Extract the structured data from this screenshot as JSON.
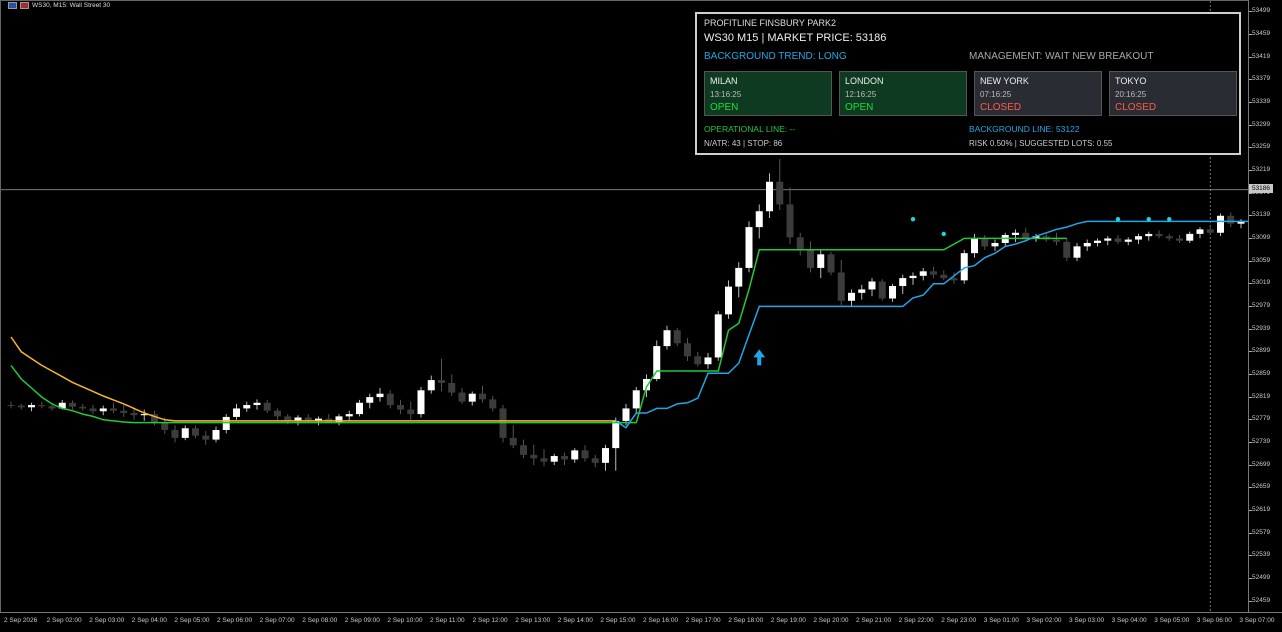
{
  "header": {
    "symbol_label": "WS30, M15:  Wall Street 30"
  },
  "info_panel": {
    "line1": "PROFITLINE FINSBURY PARK2",
    "line2": "WS30 M15  |  MARKET PRICE: 53186",
    "trend": "BACKGROUND TREND: LONG",
    "management": "MANAGEMENT: WAIT NEW BREAKOUT",
    "sessions": [
      {
        "name": "MILAN",
        "time": "13:16:25",
        "status": "OPEN"
      },
      {
        "name": "LONDON",
        "time": "12:16:25",
        "status": "OPEN"
      },
      {
        "name": "NEW YORK",
        "time": "07:16:25",
        "status": "CLOSED"
      },
      {
        "name": "TOKYO",
        "time": "20:16:25",
        "status": "CLOSED"
      }
    ],
    "operational_line": "OPERATIONAL LINE: --",
    "background_line": "BACKGROUND LINE: 53122",
    "natr": "N/ATR: 43 | STOP: 86",
    "risk": "RISK 0.50% | SUGGESTED LOTS: 0.55"
  },
  "colors": {
    "bg": "#000000",
    "bull": "#ffffff",
    "bear": "#3c3c3c",
    "yellow_line": "#f5b82a",
    "green_line": "#22c93a",
    "blue_line": "#1fa8e8",
    "cyan_dot": "#19d6e0",
    "signal_arrow": "#1fa8e8",
    "trend_text": "#1fa8e8",
    "oper_text": "#22c93a",
    "bg_line_text": "#1fa8e8"
  },
  "price_scale": {
    "ticks": [
      "53499",
      "53459",
      "53419",
      "53379",
      "53339",
      "53299",
      "53259",
      "53219",
      "53179",
      "53139",
      "53099",
      "53059",
      "53019",
      "52979",
      "52939",
      "52899",
      "52859",
      "52819",
      "52779",
      "52739",
      "52699",
      "52659",
      "52619",
      "52579",
      "52539",
      "52499",
      "52459"
    ],
    "current_price_label": "53186"
  },
  "time_scale": {
    "ticks": [
      "2 Sep 2026",
      "2 Sep 02:00",
      "2 Sep 03:00",
      "2 Sep 04:00",
      "2 Sep 05:00",
      "2 Sep 06:00",
      "2 Sep 07:00",
      "2 Sep 08:00",
      "2 Sep 09:00",
      "2 Sep 10:00",
      "2 Sep 11:00",
      "2 Sep 12:00",
      "2 Sep 13:00",
      "2 Sep 14:00",
      "2 Sep 15:00",
      "2 Sep 16:00",
      "2 Sep 17:00",
      "2 Sep 18:00",
      "2 Sep 19:00",
      "2 Sep 20:00",
      "2 Sep 21:00",
      "2 Sep 22:00",
      "2 Sep 23:00",
      "3 Sep 01:00",
      "3 Sep 02:00",
      "3 Sep 03:00",
      "3 Sep 04:00",
      "3 Sep 05:00",
      "3 Sep 06:00",
      "3 Sep 07:00"
    ]
  },
  "chart_data": {
    "type": "candlestick",
    "ylim": [
      52439,
      53519
    ],
    "current_price": 53186,
    "candles": [
      [
        52806,
        52812,
        52800,
        52805
      ],
      [
        52805,
        52808,
        52798,
        52802
      ],
      [
        52802,
        52810,
        52795,
        52806
      ],
      [
        52806,
        52812,
        52800,
        52804
      ],
      [
        52804,
        52808,
        52796,
        52800
      ],
      [
        52800,
        52815,
        52798,
        52810
      ],
      [
        52810,
        52814,
        52798,
        52803
      ],
      [
        52803,
        52808,
        52796,
        52800
      ],
      [
        52800,
        52806,
        52790,
        52795
      ],
      [
        52795,
        52805,
        52788,
        52800
      ],
      [
        52800,
        52810,
        52792,
        52796
      ],
      [
        52796,
        52806,
        52785,
        52792
      ],
      [
        52792,
        52800,
        52780,
        52788
      ],
      [
        52788,
        52798,
        52778,
        52790
      ],
      [
        52790,
        52796,
        52770,
        52776
      ],
      [
        52776,
        52784,
        52755,
        52762
      ],
      [
        52762,
        52770,
        52740,
        52748
      ],
      [
        52748,
        52770,
        52744,
        52765
      ],
      [
        52765,
        52770,
        52748,
        52752
      ],
      [
        52752,
        52760,
        52736,
        52745
      ],
      [
        52745,
        52768,
        52740,
        52762
      ],
      [
        52762,
        52790,
        52756,
        52785
      ],
      [
        52785,
        52808,
        52780,
        52800
      ],
      [
        52800,
        52812,
        52794,
        52806
      ],
      [
        52806,
        52816,
        52798,
        52810
      ],
      [
        52810,
        52815,
        52792,
        52796
      ],
      [
        52796,
        52800,
        52780,
        52786
      ],
      [
        52786,
        52790,
        52772,
        52778
      ],
      [
        52778,
        52788,
        52770,
        52784
      ],
      [
        52784,
        52790,
        52774,
        52778
      ],
      [
        52778,
        52786,
        52770,
        52782
      ],
      [
        52782,
        52790,
        52774,
        52776
      ],
      [
        52776,
        52790,
        52770,
        52786
      ],
      [
        52786,
        52796,
        52778,
        52790
      ],
      [
        52790,
        52815,
        52786,
        52810
      ],
      [
        52810,
        52826,
        52800,
        52820
      ],
      [
        52820,
        52836,
        52812,
        52826
      ],
      [
        52826,
        52832,
        52800,
        52806
      ],
      [
        52806,
        52815,
        52790,
        52798
      ],
      [
        52798,
        52812,
        52780,
        52790
      ],
      [
        52790,
        52838,
        52784,
        52832
      ],
      [
        52832,
        52858,
        52826,
        52850
      ],
      [
        52850,
        52888,
        52830,
        52845
      ],
      [
        52845,
        52860,
        52822,
        52828
      ],
      [
        52828,
        52836,
        52808,
        52812
      ],
      [
        52812,
        52830,
        52805,
        52826
      ],
      [
        52826,
        52840,
        52810,
        52816
      ],
      [
        52816,
        52822,
        52795,
        52800
      ],
      [
        52800,
        52806,
        52740,
        52748
      ],
      [
        52748,
        52770,
        52730,
        52735
      ],
      [
        52735,
        52745,
        52712,
        52718
      ],
      [
        52718,
        52736,
        52700,
        52712
      ],
      [
        52712,
        52728,
        52698,
        52706
      ],
      [
        52706,
        52720,
        52700,
        52716
      ],
      [
        52716,
        52722,
        52700,
        52710
      ],
      [
        52710,
        52730,
        52704,
        52726
      ],
      [
        52726,
        52735,
        52706,
        52712
      ],
      [
        52712,
        52718,
        52696,
        52704
      ],
      [
        52704,
        52736,
        52690,
        52730
      ],
      [
        52730,
        52784,
        52690,
        52778
      ],
      [
        52778,
        52808,
        52770,
        52800
      ],
      [
        52800,
        52838,
        52792,
        52832
      ],
      [
        52832,
        52860,
        52820,
        52852
      ],
      [
        52852,
        52920,
        52848,
        52910
      ],
      [
        52910,
        52946,
        52904,
        52938
      ],
      [
        52938,
        52942,
        52910,
        52915
      ],
      [
        52915,
        52924,
        52884,
        52892
      ],
      [
        52892,
        52900,
        52874,
        52878
      ],
      [
        52878,
        52898,
        52870,
        52890
      ],
      [
        52890,
        52972,
        52884,
        52966
      ],
      [
        52966,
        53026,
        52958,
        53015
      ],
      [
        53015,
        53058,
        52996,
        53048
      ],
      [
        53048,
        53130,
        53040,
        53120
      ],
      [
        53120,
        53160,
        53100,
        53148
      ],
      [
        53148,
        53215,
        53136,
        53200
      ],
      [
        53200,
        53240,
        53150,
        53160
      ],
      [
        53160,
        53190,
        53090,
        53102
      ],
      [
        53102,
        53110,
        53070,
        53080
      ],
      [
        53080,
        53095,
        53040,
        53048
      ],
      [
        53048,
        53080,
        53030,
        53072
      ],
      [
        53072,
        53076,
        53035,
        53040
      ],
      [
        53040,
        53062,
        52982,
        52990
      ],
      [
        52990,
        53010,
        52980,
        53004
      ],
      [
        53004,
        53018,
        52992,
        53010
      ],
      [
        53010,
        53030,
        52998,
        53024
      ],
      [
        53024,
        53028,
        52990,
        52994
      ],
      [
        52994,
        53020,
        52988,
        53016
      ],
      [
        53016,
        53036,
        53002,
        53030
      ],
      [
        53030,
        53040,
        53018,
        53034
      ],
      [
        53034,
        53048,
        53026,
        53042
      ],
      [
        53042,
        53050,
        53030,
        53036
      ],
      [
        53036,
        53044,
        53026,
        53030
      ],
      [
        53030,
        53040,
        53020,
        53026
      ],
      [
        53026,
        53080,
        53020,
        53074
      ],
      [
        53074,
        53108,
        53066,
        53100
      ],
      [
        53100,
        53106,
        53080,
        53086
      ],
      [
        53086,
        53098,
        53078,
        53092
      ],
      [
        53092,
        53110,
        53086,
        53106
      ],
      [
        53106,
        53116,
        53094,
        53110
      ],
      [
        53110,
        53118,
        53094,
        53100
      ],
      [
        53100,
        53108,
        53094,
        53104
      ],
      [
        53104,
        53108,
        53094,
        53098
      ],
      [
        53098,
        53110,
        53088,
        53094
      ],
      [
        53094,
        53100,
        53060,
        53066
      ],
      [
        53066,
        53092,
        53060,
        53086
      ],
      [
        53086,
        53098,
        53078,
        53092
      ],
      [
        53092,
        53100,
        53086,
        53096
      ],
      [
        53096,
        53104,
        53088,
        53100
      ],
      [
        53100,
        53106,
        53090,
        53094
      ],
      [
        53094,
        53102,
        53088,
        53098
      ],
      [
        53098,
        53108,
        53090,
        53104
      ],
      [
        53104,
        53112,
        53096,
        53108
      ],
      [
        53108,
        53114,
        53100,
        53104
      ],
      [
        53104,
        53108,
        53096,
        53100
      ],
      [
        53100,
        53106,
        53092,
        53096
      ],
      [
        53096,
        53112,
        53092,
        53108
      ],
      [
        53108,
        53120,
        53100,
        53116
      ],
      [
        53116,
        53122,
        53106,
        53110
      ],
      [
        53110,
        53144,
        53104,
        53140
      ],
      [
        53140,
        53146,
        53120,
        53126
      ],
      [
        53126,
        53134,
        53118,
        53130
      ],
      [
        53130,
        53142,
        53122,
        53128
      ],
      [
        53128,
        53136,
        53118,
        53124
      ],
      [
        53124,
        53132,
        53116,
        53126
      ],
      [
        53126,
        53134,
        53118,
        53122
      ],
      [
        53122,
        53130,
        53116,
        53124
      ],
      [
        53124,
        53130,
        53118,
        53126
      ]
    ],
    "yellow_line": [
      52926,
      52900,
      52888,
      52876,
      52866,
      52856,
      52846,
      52838,
      52830,
      52822,
      52815,
      52808,
      52800,
      52792,
      52786,
      52780,
      52778,
      52778,
      52778,
      52778,
      52778,
      52778,
      52778,
      52778,
      52778,
      52778,
      52778,
      52778,
      52778,
      52778,
      52778,
      52778,
      52778,
      52778,
      52778,
      52778,
      52778,
      52778,
      52778,
      52778,
      52778,
      52778,
      52778,
      52778,
      52778,
      52778,
      52778,
      52778,
      52778,
      52778,
      52778,
      52778,
      52778,
      52778,
      52778,
      52778,
      52778,
      52778,
      52778,
      52778
    ],
    "green_line": [
      52876,
      52852,
      52836,
      52820,
      52808,
      52800,
      52796,
      52790,
      52786,
      52780,
      52778,
      52776,
      52775,
      52775,
      52775,
      52775,
      52775,
      52775,
      52775,
      52775,
      52775,
      52775,
      52775,
      52775,
      52775,
      52775,
      52775,
      52775,
      52775,
      52775,
      52775,
      52775,
      52775,
      52775,
      52775,
      52775,
      52775,
      52775,
      52775,
      52775,
      52775,
      52775,
      52775,
      52775,
      52775,
      52775,
      52775,
      52775,
      52775,
      52775,
      52775,
      52775,
      52775,
      52775,
      52775,
      52775,
      52775,
      52775,
      52775,
      52775,
      52775,
      52775,
      52838,
      52866,
      52866,
      52866,
      52866,
      52866,
      52866,
      52866,
      52938,
      52950,
      53010,
      53080,
      53080,
      53080,
      53080,
      53080,
      53080,
      53080,
      53080,
      53080,
      53080,
      53080,
      53080,
      53080,
      53080,
      53080,
      53080,
      53080,
      53080,
      53080,
      53090,
      53100,
      53100,
      53100,
      53100,
      53100,
      53100,
      53100,
      53100,
      53100,
      53100,
      53100
    ],
    "blue_line": [
      null,
      null,
      null,
      null,
      null,
      null,
      null,
      null,
      null,
      null,
      null,
      null,
      null,
      null,
      null,
      null,
      null,
      null,
      null,
      null,
      null,
      null,
      null,
      null,
      null,
      null,
      null,
      null,
      null,
      null,
      null,
      null,
      null,
      null,
      null,
      null,
      null,
      null,
      null,
      null,
      null,
      null,
      null,
      null,
      null,
      null,
      null,
      null,
      null,
      null,
      null,
      null,
      null,
      null,
      null,
      null,
      null,
      null,
      null,
      52778,
      52766,
      52792,
      52792,
      52800,
      52800,
      52808,
      52810,
      52818,
      52862,
      52862,
      52862,
      52880,
      52930,
      52980,
      52980,
      52980,
      52980,
      52980,
      52980,
      52980,
      52980,
      52980,
      52980,
      52980,
      52980,
      52980,
      52980,
      52980,
      52995,
      53000,
      53020,
      53020,
      53034,
      53048,
      53052,
      53066,
      53074,
      53086,
      53090,
      53096,
      53104,
      53110,
      53116,
      53120,
      53126,
      53130,
      53130,
      53130,
      53130,
      53130,
      53130,
      53130,
      53130,
      53130,
      53130,
      53130,
      53130,
      53130,
      53130,
      53130,
      53130,
      53130,
      53130,
      53130,
      53130,
      53130,
      53130,
      53130,
      53130,
      53130,
      53130,
      53130,
      53130,
      53130
    ],
    "dots": [
      [
        88,
        53134
      ],
      [
        91,
        53108
      ],
      [
        108,
        53134
      ],
      [
        111,
        53134
      ],
      [
        113,
        53134
      ]
    ],
    "arrow": [
      73,
      52890
    ],
    "dashed_vline_index": 117
  }
}
